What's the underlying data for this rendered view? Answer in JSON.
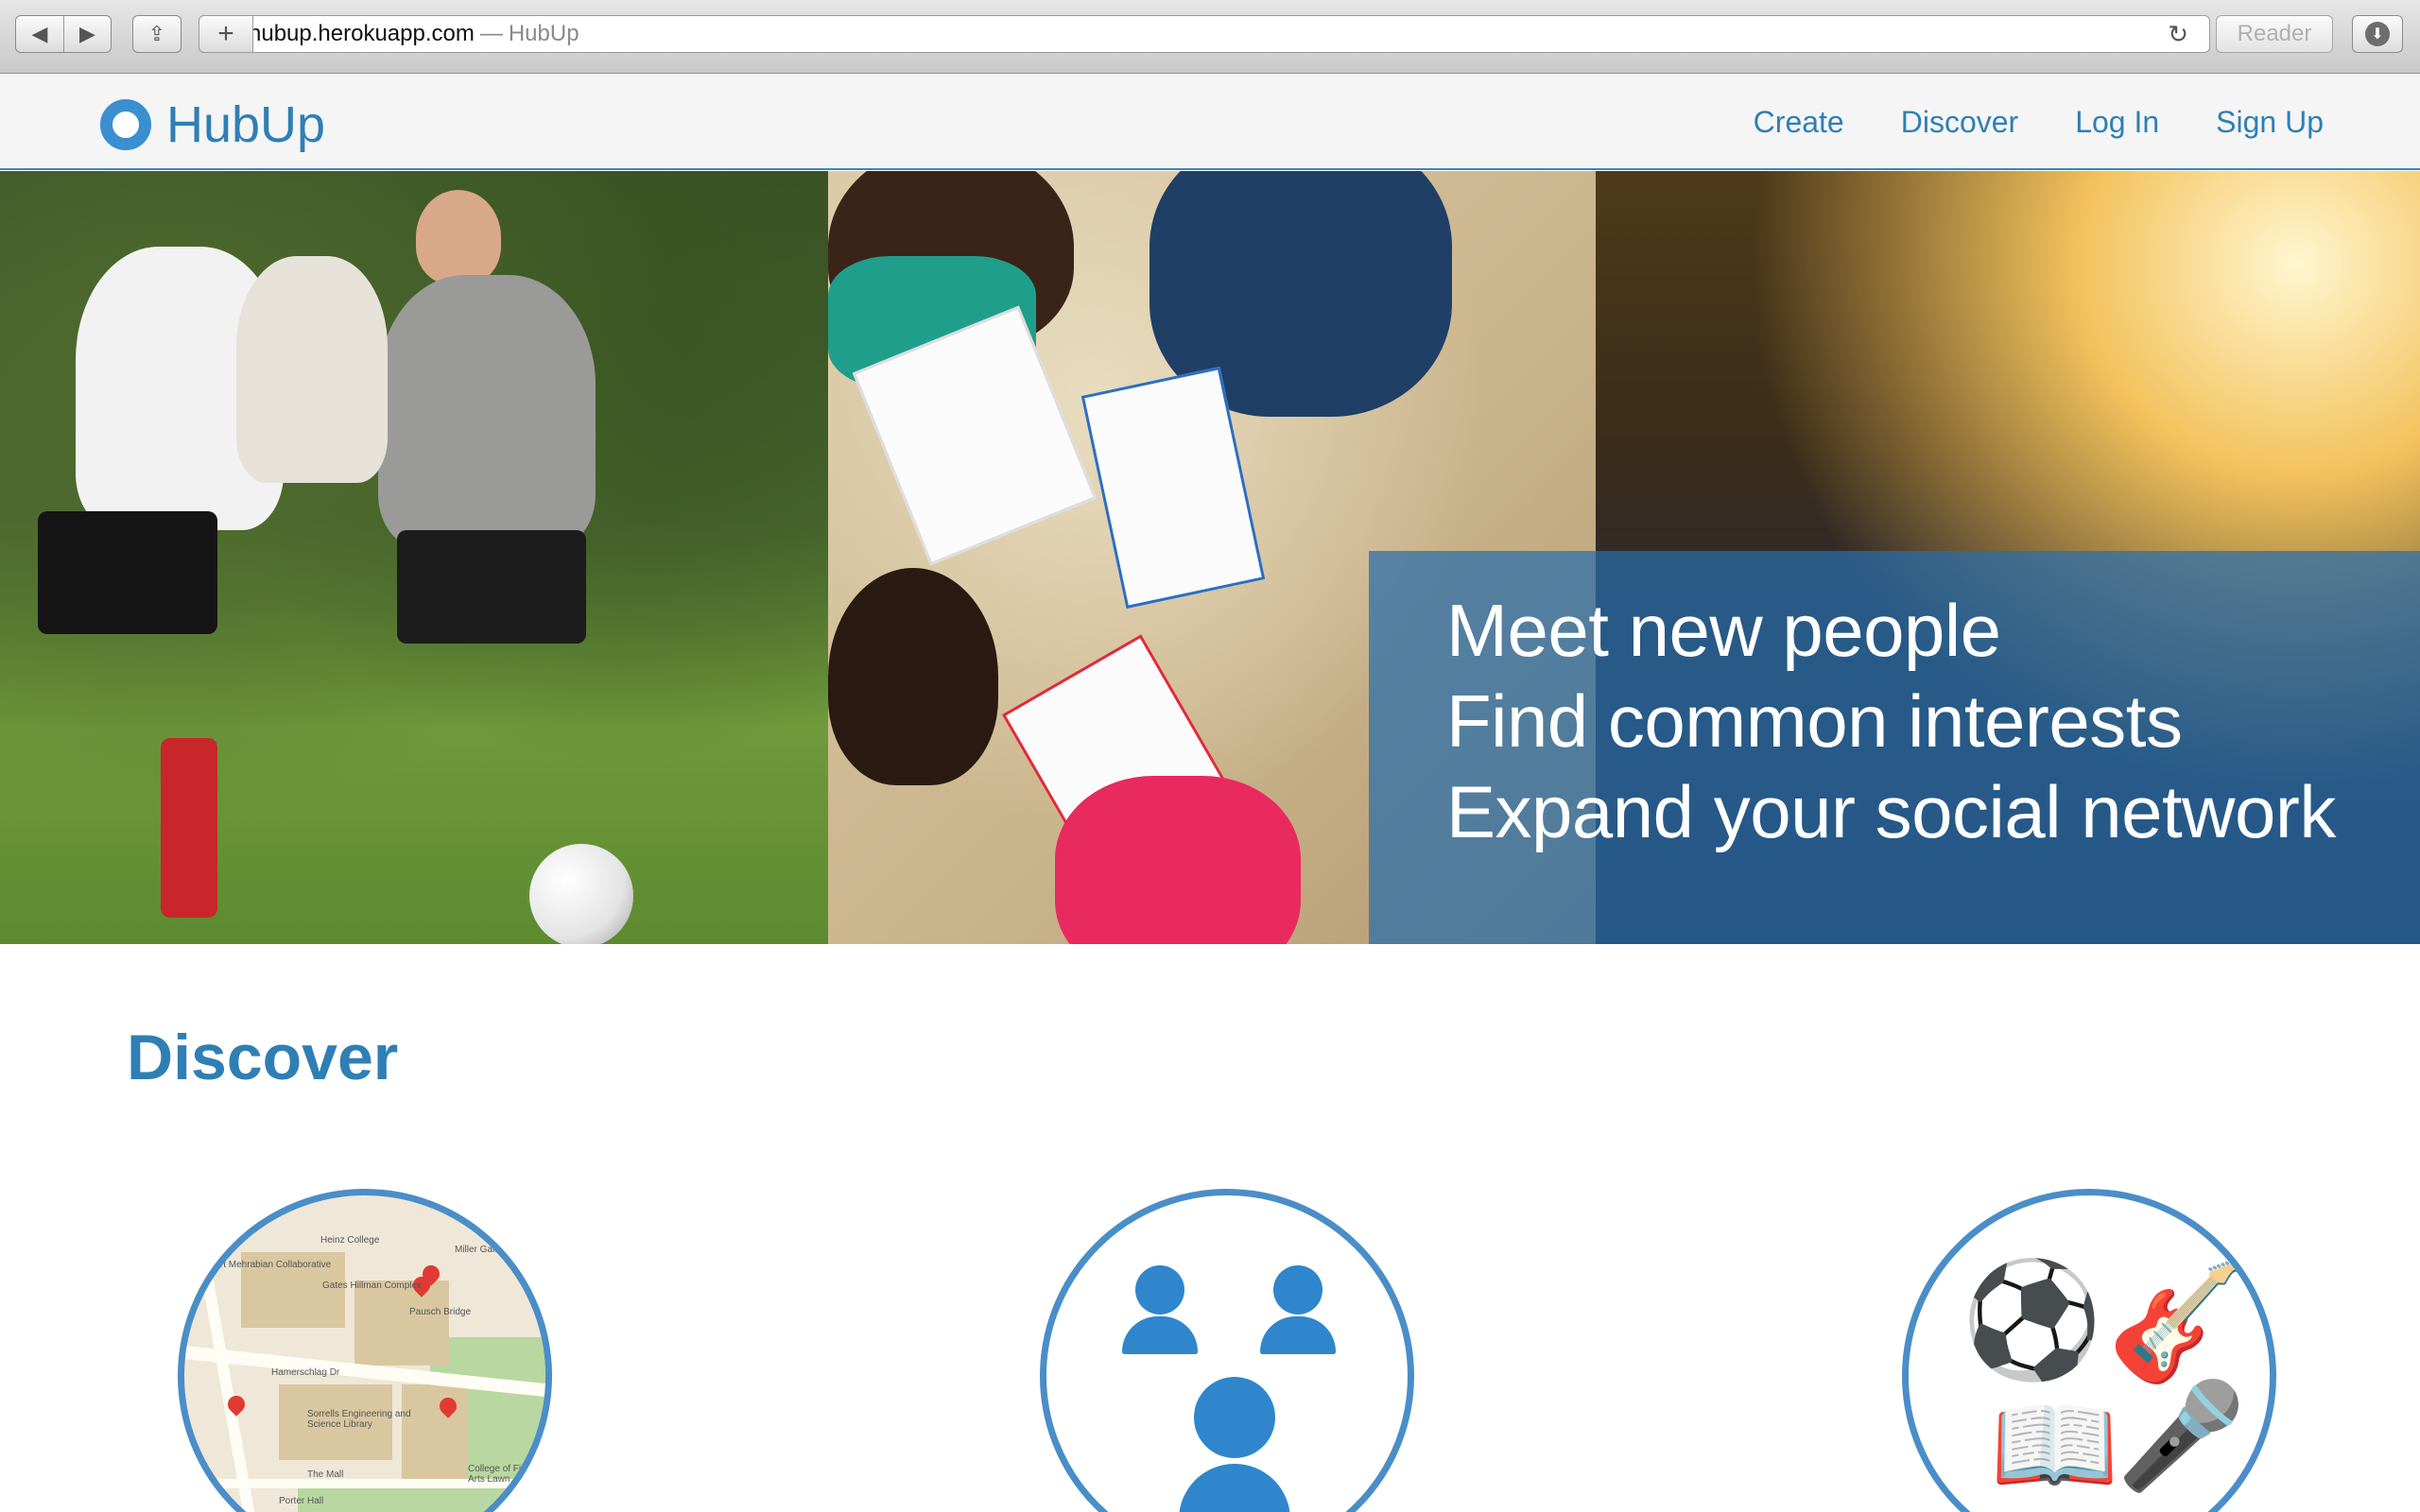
{
  "browser": {
    "url": "hubup.herokuapp.com",
    "separator": "—",
    "page_title": "HubUp",
    "reader_label": "Reader",
    "icons": {
      "back": "back-arrow-icon",
      "forward": "forward-arrow-icon",
      "share": "share-icon",
      "new_tab": "plus-icon",
      "reload": "reload-icon",
      "download": "download-icon"
    }
  },
  "navbar": {
    "brand": "HubUp",
    "links": [
      "Create",
      "Discover",
      "Log In",
      "Sign Up"
    ]
  },
  "hero": {
    "lines": [
      "Meet new people",
      "Find common interests",
      "Expand your social network"
    ],
    "slide_count": 3,
    "active_slide": 2
  },
  "discover": {
    "title": "Discover",
    "map_labels": [
      "Heinz College",
      "Miller Gallery at Mellon Institute",
      "Robert Mehrabian Collaborative",
      "Gates Hillman Complex",
      "Pausch Bridge",
      "Hamerschlag Dr",
      "Sorrells Engineering and Science Library",
      "The Mall",
      "College of Fine Arts Lawn",
      "Porter Hall"
    ],
    "cards": [
      {
        "icon": "map-icon"
      },
      {
        "icon": "people-group-icon"
      },
      {
        "icon": "interests-icon"
      }
    ]
  },
  "colors": {
    "brand": "#2f7fb5",
    "caption_bg": "#286eaa",
    "circle_border": "#4a8ec8"
  }
}
